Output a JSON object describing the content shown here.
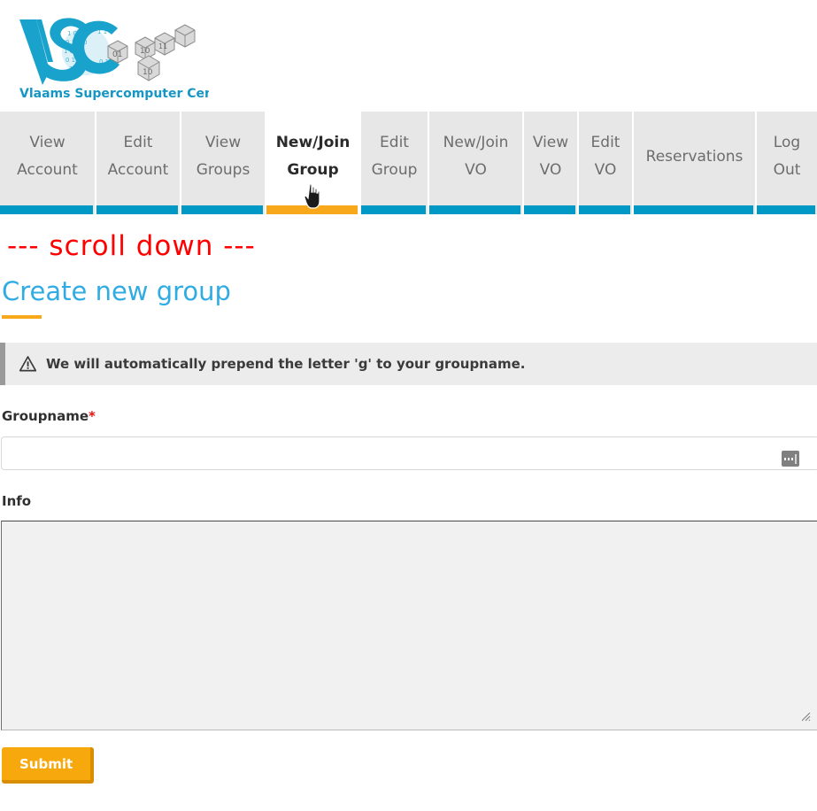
{
  "brand": {
    "logo_letters": "VSC",
    "logo_tagline": "Vlaams Supercomputer Centrum",
    "logo_name": "vsc-logo"
  },
  "nav": {
    "tabs": [
      {
        "line1": "View",
        "line2": "Account",
        "active": false
      },
      {
        "line1": "Edit",
        "line2": "Account",
        "active": false
      },
      {
        "line1": "View",
        "line2": "Groups",
        "active": false
      },
      {
        "line1": "New/Join",
        "line2": "Group",
        "active": true
      },
      {
        "line1": "Edit",
        "line2": "Group",
        "active": false
      },
      {
        "line1": "New/Join",
        "line2": "VO",
        "active": false
      },
      {
        "line1": "View",
        "line2": "VO",
        "active": false
      },
      {
        "line1": "Edit",
        "line2": "VO",
        "active": false
      },
      {
        "line1": "Reservations",
        "line2": "",
        "active": false
      },
      {
        "line1": "Log",
        "line2": "Out",
        "active": false
      }
    ]
  },
  "notice": {
    "scroll_hint": "--- scroll down ---"
  },
  "main": {
    "page_title": "Create new group",
    "alert": {
      "icon": "warning-triangle-icon",
      "text": "We will automatically prepend the letter 'g' to your groupname."
    },
    "groupname": {
      "label": "Groupname",
      "required_marker": "*",
      "value": "",
      "placeholder": ""
    },
    "info": {
      "label": "Info",
      "value": "",
      "placeholder": ""
    },
    "submit_label": "Submit"
  },
  "colors": {
    "accent_blue": "#0099c6",
    "accent_orange": "#f7a81b",
    "title_blue": "#30ace3",
    "alert_bg": "#ececec",
    "alert_border": "#999999",
    "tab_bg": "#e7e7e7",
    "red": "#ff0000"
  }
}
